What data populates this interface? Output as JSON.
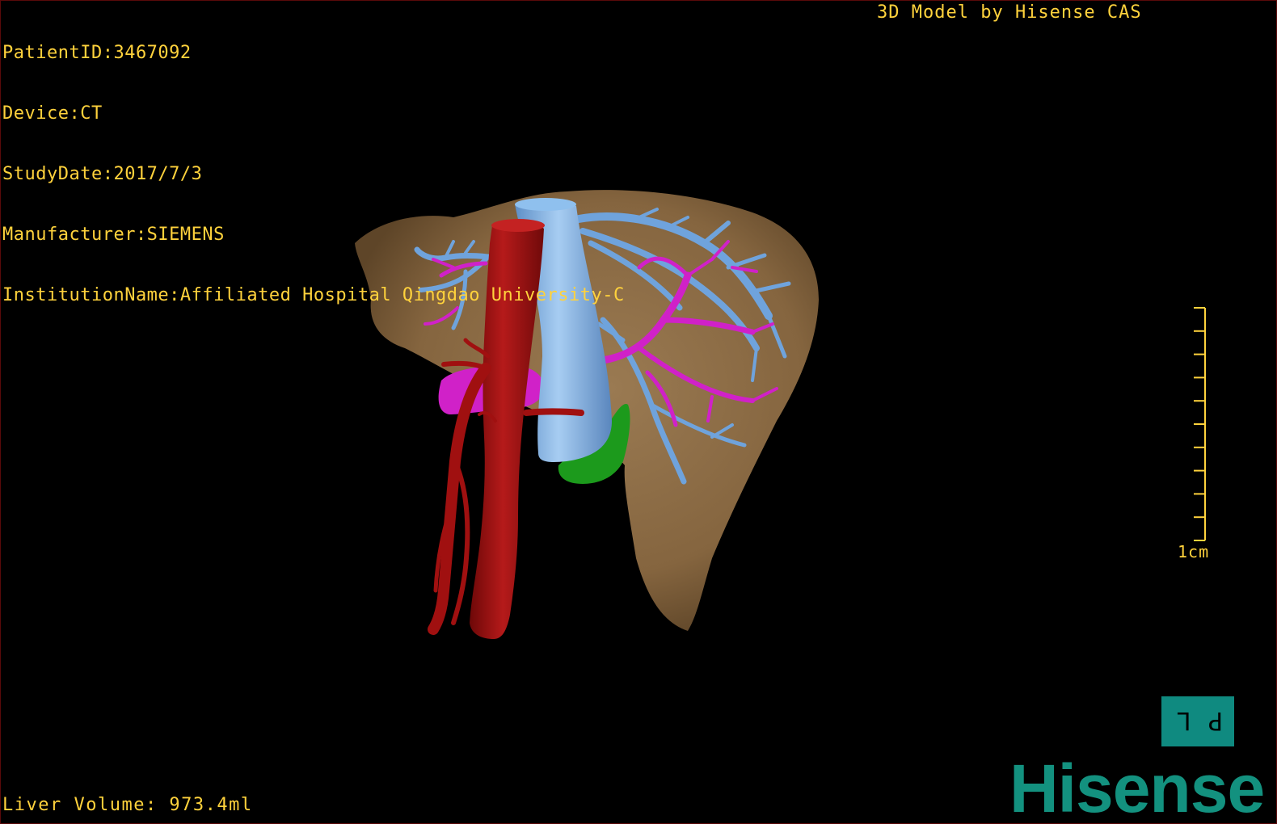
{
  "overlay": {
    "patient_id": "PatientID:3467092",
    "device": "Device:CT",
    "study_date": "StudyDate:2017/7/3",
    "manufacturer": "Manufacturer:SIEMENS",
    "institution": "InstitutionName:Affiliated Hospital Qingdao University-C",
    "brand_top": "3D Model by Hisense CAS",
    "liver_volume": "Liver Volume: 973.4ml"
  },
  "scale": {
    "label": "1cm",
    "tick_count": 10
  },
  "orientation": {
    "label": "P L"
  },
  "logo": {
    "text": "Hisense"
  },
  "colors": {
    "text": "#ffd23c",
    "liver": "#8a6a45",
    "aorta": "#a01010",
    "ivc": "#7fb2e6",
    "hepatic_vein": "#6fa3dc",
    "portal_vein": "#d021c8",
    "gallbladder": "#1c9a1c",
    "brand": "#13917f"
  }
}
